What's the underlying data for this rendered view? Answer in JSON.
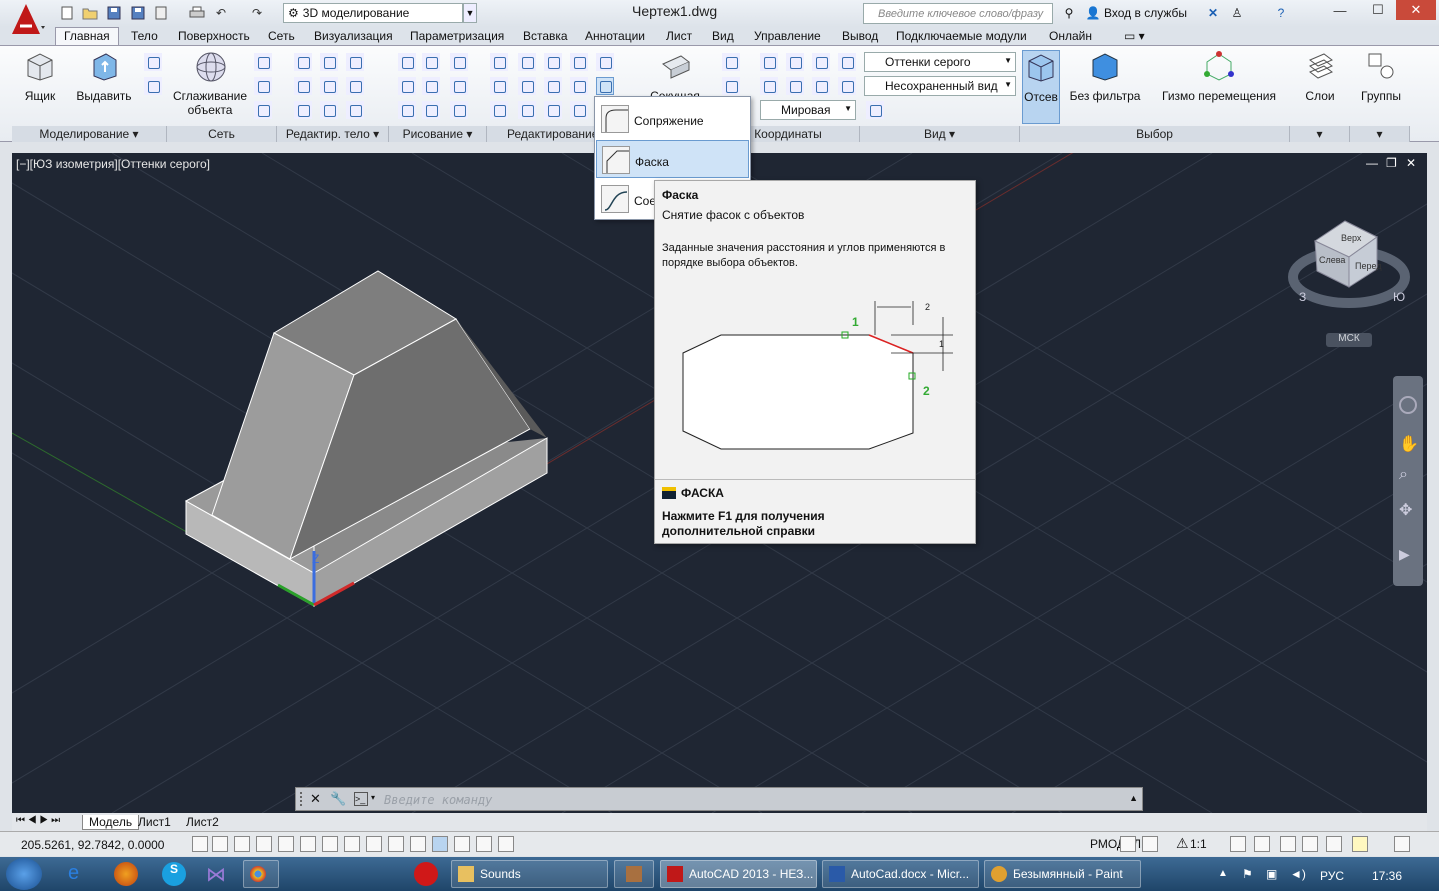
{
  "titlebar": {
    "workspace": "3D моделирование",
    "window_title": "Чертеж1.dwg",
    "search_placeholder": "Введите ключевое слово/фразу",
    "login": "Вход в службы"
  },
  "tabs": [
    "Главная",
    "Тело",
    "Поверхность",
    "Сеть",
    "Визуализация",
    "Параметризация",
    "Вставка",
    "Аннотации",
    "Лист",
    "Вид",
    "Управление",
    "Вывод",
    "Подключаемые модули",
    "Онлайн"
  ],
  "ribbon": {
    "box_label": "Ящик",
    "extrude_label": "Выдавить",
    "smooth_label_1": "Сглаживание",
    "smooth_label_2": "объекта",
    "section_label": "Секущая",
    "visual_style": "Оттенки серого",
    "unsaved_view": "Несохраненный вид",
    "world": "Мировая",
    "culling_label": "Отсев",
    "no_filter_label": "Без фильтра",
    "gizmo_label": "Гизмо перемещения",
    "layers_label": "Слои",
    "groups_label": "Группы",
    "panels": [
      "Моделирование",
      "Сеть",
      "Редактир. тело",
      "Рисование",
      "Редактирование",
      "Координаты",
      "Вид",
      "Выбор"
    ]
  },
  "viewport": {
    "label": "[−][ЮЗ изометрия][Оттенки серого]",
    "viewcube_top": "Верх",
    "viewcube_left": "Слева",
    "viewcube_front": "Перед",
    "compass_w": "З",
    "compass_s": "Ю",
    "mcs": "МСК"
  },
  "flyout": {
    "items": [
      "Сопряжение",
      "Фаска",
      "Сое"
    ]
  },
  "tooltip": {
    "title": "Фаска",
    "desc": "Снятие фасок с объектов",
    "long": "Заданные значения расстояния и углов применяются в порядке выбора объектов.",
    "dim1": "2",
    "dim2": "1",
    "pt1": "1",
    "pt2": "2",
    "command": "ФАСКА",
    "help": "Нажмите F1 для получения дополнительной справки"
  },
  "cmdline": {
    "placeholder": "Введите команду"
  },
  "layouts": [
    "Модель",
    "Лист1",
    "Лист2"
  ],
  "status": {
    "coords": "205.5261, 92.7842, 0.0000",
    "rmodel": "РМОДЕЛЬ",
    "scale": "1:1"
  },
  "taskbar": {
    "sounds": "Sounds",
    "autocad": "AutoCAD 2013 - НЕЗ...",
    "word": "AutoCad.docx - Micr...",
    "paint": "Безымянный - Paint",
    "lang": "РУС",
    "time": "17:36"
  }
}
